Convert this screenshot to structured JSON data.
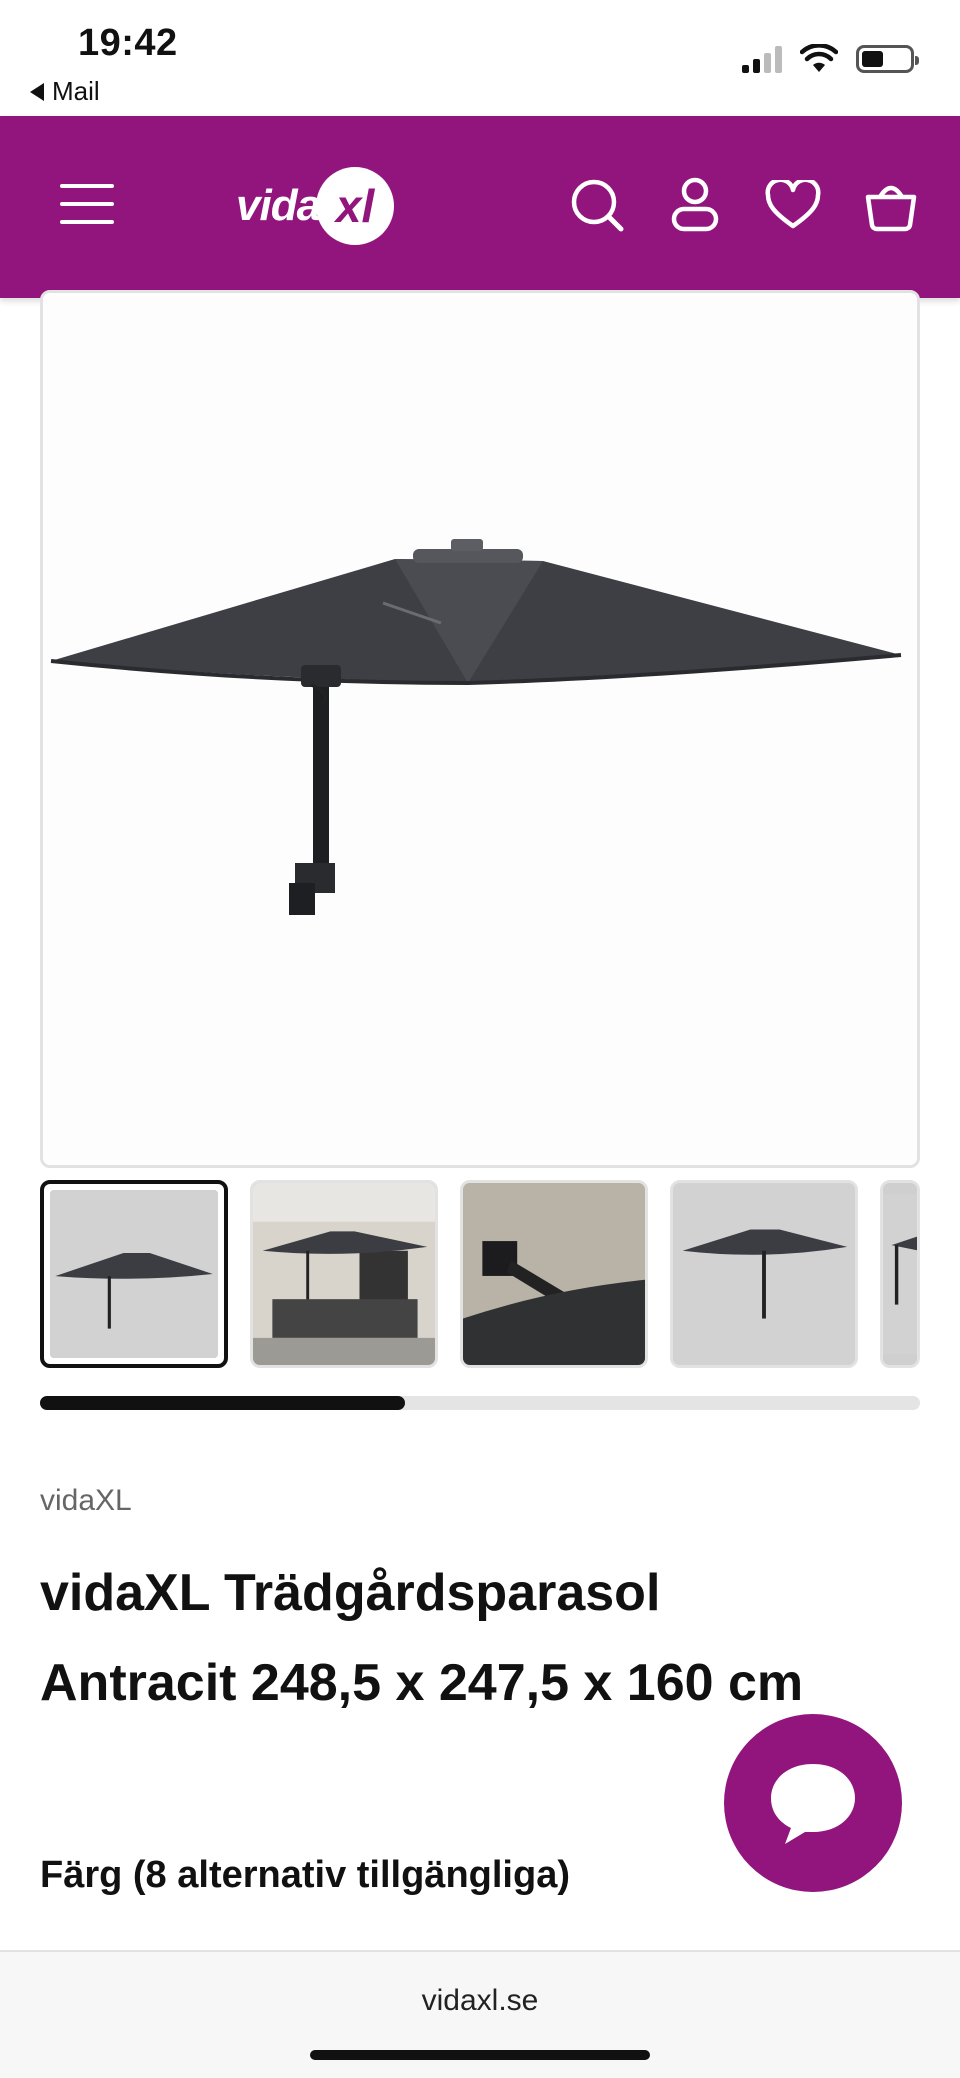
{
  "status_bar": {
    "time": "19:42",
    "back_app": "Mail",
    "battery_level": 0.45,
    "signal_bars_active": 2
  },
  "header": {
    "logo_text": "vida",
    "logo_badge": "xl",
    "brand_color": "#92157d",
    "icons": [
      "menu-icon",
      "search-icon",
      "account-icon",
      "heart-icon",
      "cart-icon"
    ]
  },
  "gallery": {
    "thumbnail_count_visible": 5,
    "active_thumbnail": 0,
    "scroll_progress": 0.415
  },
  "product": {
    "brand": "vidaXL",
    "title_line1": "vidaXL Trädgårdsparasol",
    "title_line2": "Antracit 248,5 x 247,5 x 160 cm",
    "color_label": "Färg (8 alternativ tillgängliga)"
  },
  "browser": {
    "url": "vidaxl.se"
  }
}
